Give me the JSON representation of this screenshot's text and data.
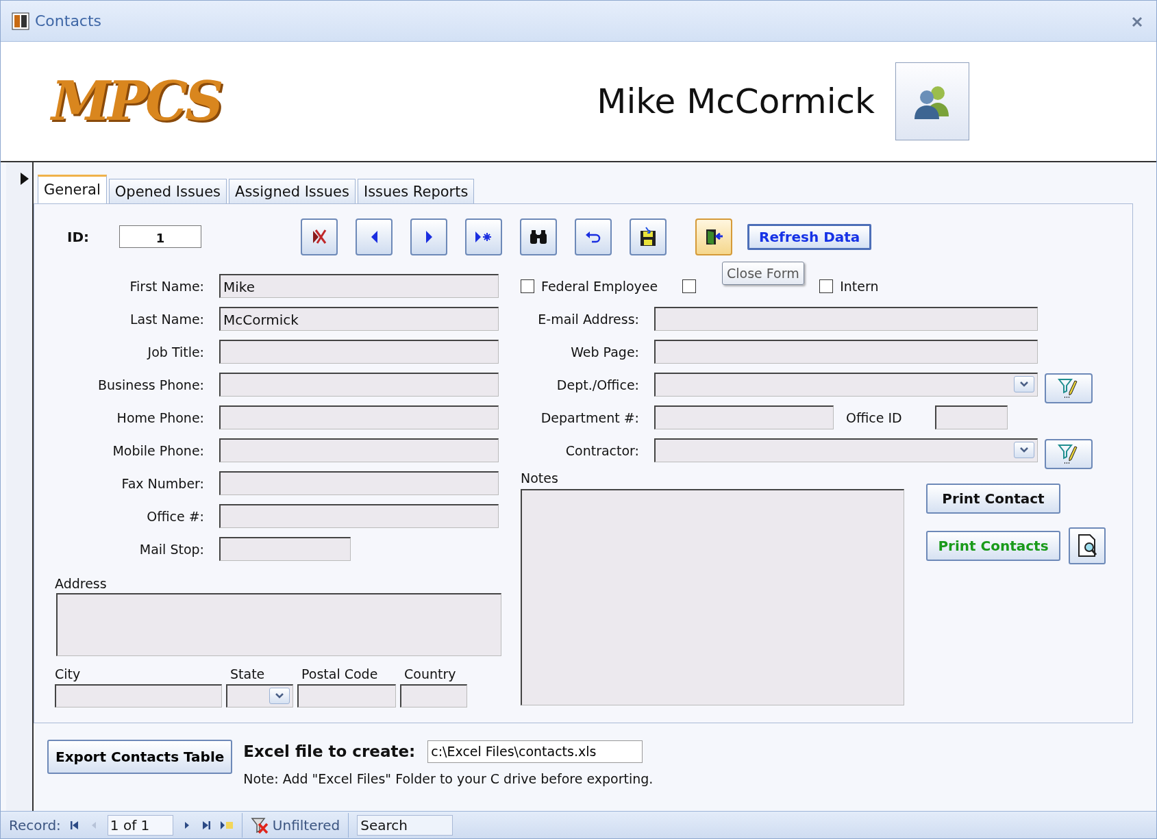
{
  "window": {
    "title": "Contacts"
  },
  "header": {
    "logo": "MPCS",
    "contact_name": "Mike McCormick"
  },
  "tabs": [
    {
      "label": "General",
      "selected": true
    },
    {
      "label": "Opened Issues",
      "selected": false
    },
    {
      "label": "Assigned Issues",
      "selected": false
    },
    {
      "label": "Issues Reports",
      "selected": false
    }
  ],
  "toolbar": {
    "id_label": "ID:",
    "id_value": "1",
    "buttons": [
      {
        "kind": "delete",
        "hovered": false
      },
      {
        "kind": "previous",
        "hovered": false
      },
      {
        "kind": "next",
        "hovered": false
      },
      {
        "kind": "new",
        "hovered": false
      },
      {
        "kind": "find",
        "hovered": false
      },
      {
        "kind": "undo",
        "hovered": false
      },
      {
        "kind": "save",
        "hovered": false
      },
      {
        "kind": "close",
        "hovered": true
      }
    ],
    "refresh_button": "Refresh Data",
    "tooltip": "Close Form"
  },
  "checkboxes": [
    {
      "label": "Federal Employee",
      "checked": false
    },
    {
      "checked": false
    },
    {
      "label": "Intern",
      "checked": false
    }
  ],
  "left_fields": [
    {
      "label": "First Name:",
      "value": "Mike",
      "kind": "text"
    },
    {
      "label": "Last Name:",
      "value": "McCormick",
      "kind": "text"
    },
    {
      "label": "Job Title:",
      "kind": "text"
    },
    {
      "label": "Business Phone:",
      "kind": "text"
    },
    {
      "label": "Home Phone:",
      "kind": "text"
    },
    {
      "label": "Mobile Phone:",
      "kind": "text"
    },
    {
      "label": "Fax Number:",
      "kind": "text"
    },
    {
      "label": "Office #:",
      "kind": "text"
    },
    {
      "label": "Mail Stop:",
      "kind": "short"
    }
  ],
  "right_fields": [
    {
      "label": "E-mail Address:",
      "kind": "text"
    },
    {
      "label": "Web Page:",
      "kind": "text"
    },
    {
      "label": "Dept./Office:",
      "kind": "combo_filter"
    },
    {
      "label": "Department #:",
      "kind": "pair",
      "second_label": "Office ID"
    },
    {
      "label": "Contractor:",
      "kind": "combo_filter"
    }
  ],
  "address": {
    "label": "Address",
    "city": "City",
    "state": "State",
    "postal_code": "Postal Code",
    "country": "Country"
  },
  "notes": {
    "label": "Notes"
  },
  "print": {
    "contact_button": "Print Contact",
    "contacts_button": "Print Contacts"
  },
  "export": {
    "button": "Export Contacts Table",
    "label": "Excel file to create:",
    "value": "c:\\Excel Files\\contacts.xls",
    "note": "Note: Add \"Excel Files\" Folder to your C drive before exporting."
  },
  "status_bar": {
    "record_label": "Record:",
    "position": "1 of 1",
    "filter": "Unfiltered",
    "search_placeholder": "Search"
  }
}
